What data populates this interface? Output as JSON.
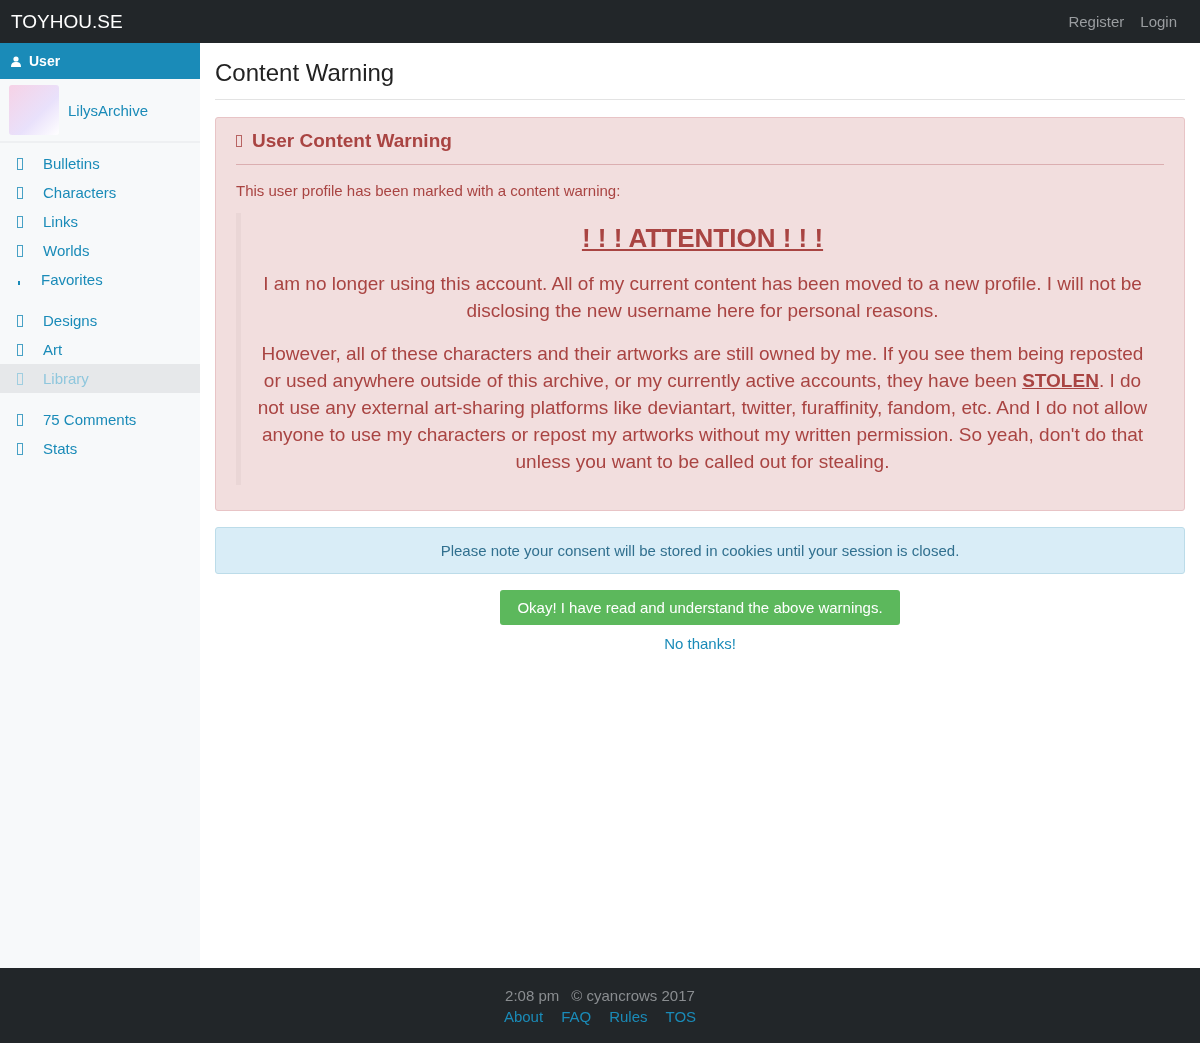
{
  "navbar": {
    "brand": "TOYHOU.SE",
    "links": [
      "Register",
      "Login"
    ]
  },
  "sidebar": {
    "header": "User",
    "username": "LilysArchive",
    "groups": [
      [
        {
          "label": "Bulletins",
          "selected": false
        },
        {
          "label": "Characters",
          "selected": false
        },
        {
          "label": "Links",
          "selected": false
        },
        {
          "label": "Worlds",
          "selected": false
        },
        {
          "label": "Favorites",
          "selected": false
        }
      ],
      [
        {
          "label": "Designs",
          "selected": false
        },
        {
          "label": "Art",
          "selected": false
        },
        {
          "label": "Library",
          "selected": true
        }
      ],
      [
        {
          "label": "75 Comments",
          "selected": false
        },
        {
          "label": "Stats",
          "selected": false
        }
      ]
    ]
  },
  "page_title": "Content Warning",
  "warning": {
    "title": "User Content Warning",
    "intro": "This user profile has been marked with a content warning:",
    "heading": "! ! ! ATTENTION ! ! !",
    "paragraphs": [
      "I am no longer using this account. All of my current content has been moved to a new profile. I will not be disclosing the new username here for personal reasons.",
      "However, all of these characters and their artworks are still owned by me. If you see them being reposted or used anywhere outside of this archive, or my currently active accounts, they have been **STOLEN**. I do not use any external art-sharing platforms like deviantart, twitter, furaffinity, fandom, etc. And I do not allow anyone to use my characters or repost my artworks without my written permission. So yeah, don't do that unless you want to be called out for stealing."
    ]
  },
  "notice": "Please note your consent will be stored in cookies until your session is closed.",
  "accept_button": "Okay! I have read and understand the above warnings.",
  "decline_link": "No thanks!",
  "footer": {
    "time": "2:08 pm",
    "copyright": "© cyancrows 2017",
    "links": [
      "About",
      "FAQ",
      "Rules",
      "TOS"
    ]
  }
}
